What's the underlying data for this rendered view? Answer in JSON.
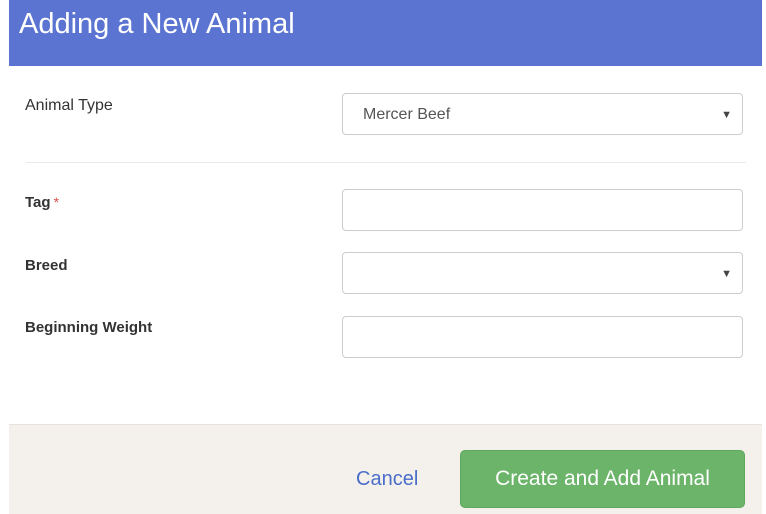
{
  "modal": {
    "title": "Adding a New Animal"
  },
  "form": {
    "animal_type": {
      "label": "Animal Type",
      "value": "Mercer Beef"
    },
    "tag": {
      "label": "Tag",
      "required_marker": "*",
      "value": ""
    },
    "breed": {
      "label": "Breed",
      "value": ""
    },
    "beginning_weight": {
      "label": "Beginning Weight",
      "value": ""
    }
  },
  "footer": {
    "cancel_label": "Cancel",
    "submit_label": "Create and Add Animal"
  },
  "icons": {
    "select_arrow": "chevron-down-icon"
  },
  "colors": {
    "header": "#5b74d1",
    "submit": "#6cb46a",
    "link": "#4a6dc9",
    "required": "#d9534f",
    "footer": "#f4f1ed"
  }
}
